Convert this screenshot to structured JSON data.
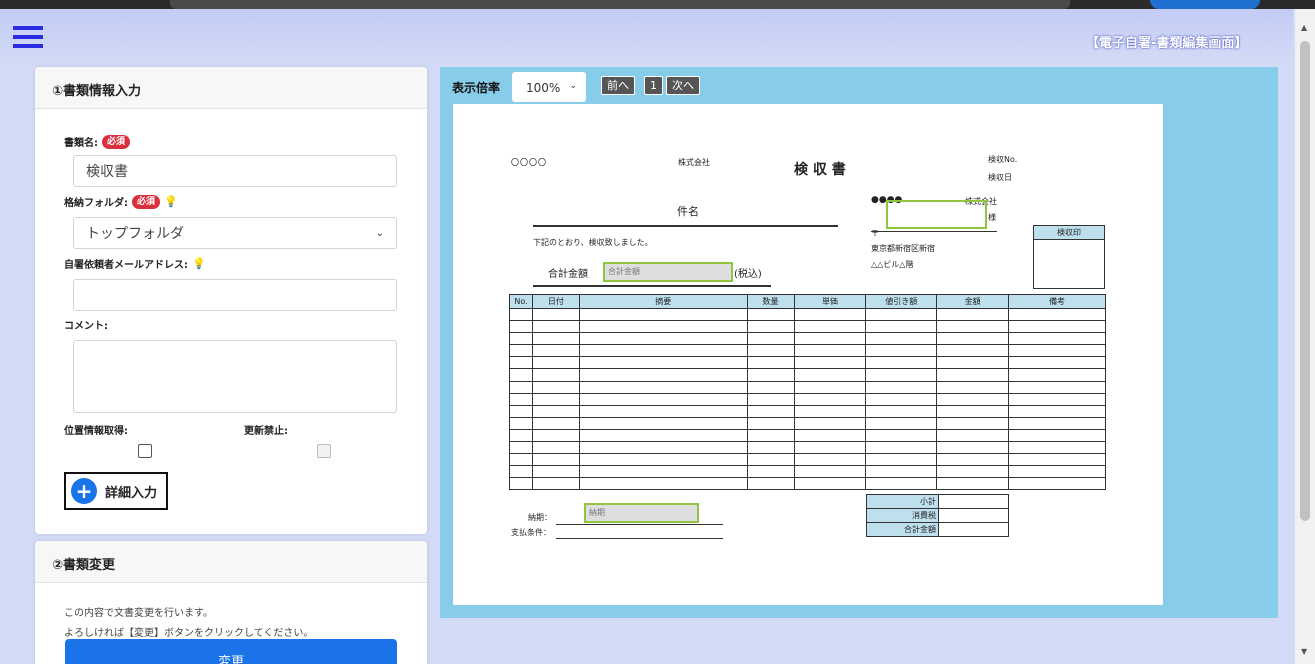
{
  "header": {
    "screen_title": "【電子自署-書類編集画面】"
  },
  "section1": {
    "title": "①書類情報入力",
    "doc_name_label": "書類名:",
    "doc_name_value": "検収書",
    "folder_label": "格納フォルダ:",
    "folder_value": "トップフォルダ",
    "email_label": "自署依頼者メールアドレス:",
    "email_value": "",
    "comment_label": "コメント:",
    "comment_value": "",
    "location_label": "位置情報取得:",
    "lock_label": "更新禁止:",
    "location_checked": false,
    "lock_checked": false,
    "detail_button": "詳細入力",
    "required_badge": "必須"
  },
  "section2": {
    "title": "②書類変更",
    "line1": "この内容で文書変更を行います。",
    "line2": "よろしければ【変更】ボタンをクリックしてください。",
    "change_button": "変更"
  },
  "viewer": {
    "zoom_label": "表示倍率",
    "zoom_value": "100%",
    "prev_button": "前へ",
    "page_number": "1",
    "next_button": "次へ"
  },
  "document": {
    "recipient": "〇〇〇〇",
    "company_suffix": "株式会社",
    "title": "検 収 書",
    "inspection_no": "検収No.",
    "inspection_date": "検収日",
    "subject_label": "件名",
    "issuer_dots": "●●●●",
    "issuer_company": "株式会社",
    "honorific": "様",
    "statement": "下記のとおり、検収致しました。",
    "postal": "〒",
    "address1": "東京都新宿区新宿",
    "address2": "△△ビル△階",
    "total_label": "合計金額",
    "total_placeholder": "合計金額",
    "tax_included": "(税込)",
    "stamp_label": "検収印",
    "columns": [
      "No.",
      "日付",
      "摘要",
      "数量",
      "単価",
      "値引き額",
      "金額",
      "備考"
    ],
    "summary": [
      "小計",
      "消費税",
      "合計金額"
    ],
    "due_label": "納期：",
    "due_placeholder": "納期",
    "payment_label": "支払条件："
  }
}
